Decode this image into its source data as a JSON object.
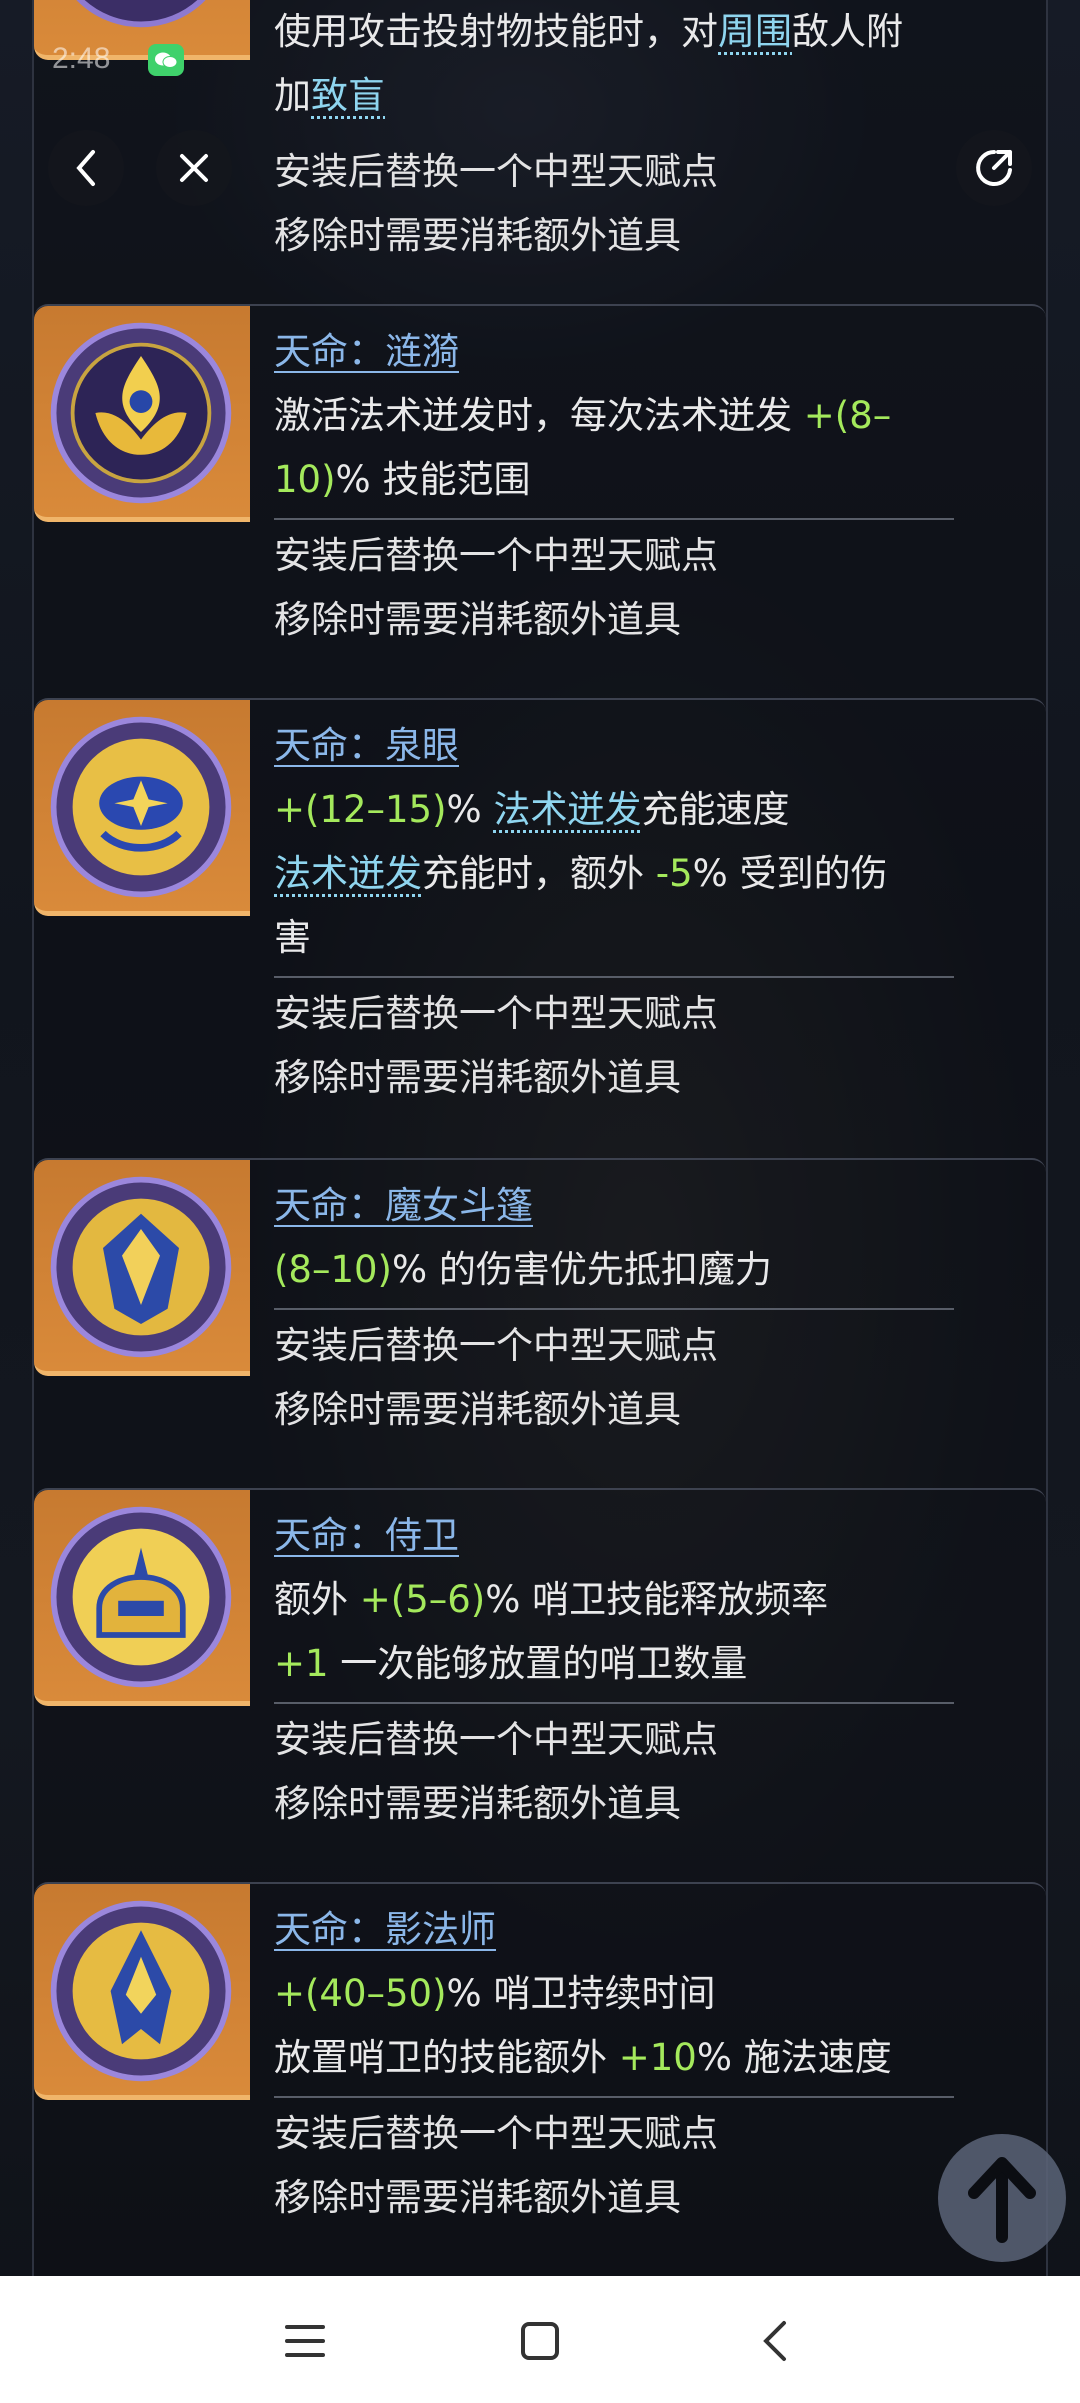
{
  "status": {
    "time": "2:48"
  },
  "top_entry": {
    "line1_pre": "使用攻击投射物技能时，对",
    "line1_kw": "周围",
    "line1_post": "敌人附",
    "line2_pre": "加",
    "line2_kw": "致盲",
    "install": "安装后替换一个中型天赋点",
    "remove": "移除时需要消耗额外道具"
  },
  "entries": [
    {
      "icon": "lotus-emblem-icon",
      "title": "天命：涟漪",
      "l1_a": "激活法术迸发时，每次法术迸发 ",
      "l1_g": "+(8–",
      "l2_g": "10)",
      "l2_b": "% 技能范围",
      "install": "安装后替换一个中型天赋点",
      "remove": "移除时需要消耗额外道具"
    },
    {
      "icon": "spring-eye-emblem-icon",
      "title": "天命：泉眼",
      "l1_g": "+(12–15)",
      "l1_b": "% ",
      "l1_kw": "法术迸发",
      "l1_c": "充能速度",
      "l2_kw": "法术迸发",
      "l2_a": "充能时，额外 ",
      "l2_g": "-5",
      "l2_b": "% 受到的伤",
      "l3": "害",
      "install": "安装后替换一个中型天赋点",
      "remove": "移除时需要消耗额外道具"
    },
    {
      "icon": "witch-cloak-emblem-icon",
      "title": "天命：魔女斗篷",
      "l1_g": "(8–10)",
      "l1_b": "% 的伤害优先抵扣魔力",
      "install": "安装后替换一个中型天赋点",
      "remove": "移除时需要消耗额外道具"
    },
    {
      "icon": "guard-helmet-emblem-icon",
      "title": "天命：侍卫",
      "l1_a": "额外 ",
      "l1_g": "+(5–6)",
      "l1_b": "% 哨卫技能释放频率",
      "l2_g": "+1",
      "l2_b": " 一次能够放置的哨卫数量",
      "install": "安装后替换一个中型天赋点",
      "remove": "移除时需要消耗额外道具"
    },
    {
      "icon": "shadow-mage-emblem-icon",
      "title": "天命：影法师",
      "l1_g": "+(40–50)",
      "l1_b": "% 哨卫持续时间",
      "l2_a": "放置哨卫的技能额外 ",
      "l2_g": "+10",
      "l2_b": "% 施法速度",
      "install": "安装后替换一个中型天赋点",
      "remove": "移除时需要消耗额外道具"
    }
  ],
  "colors": {
    "title": "#8bb7e9",
    "highlight_green": "#a4e95c",
    "keyword": "#8fd5ef",
    "icon_bg": "#d98a3a"
  }
}
